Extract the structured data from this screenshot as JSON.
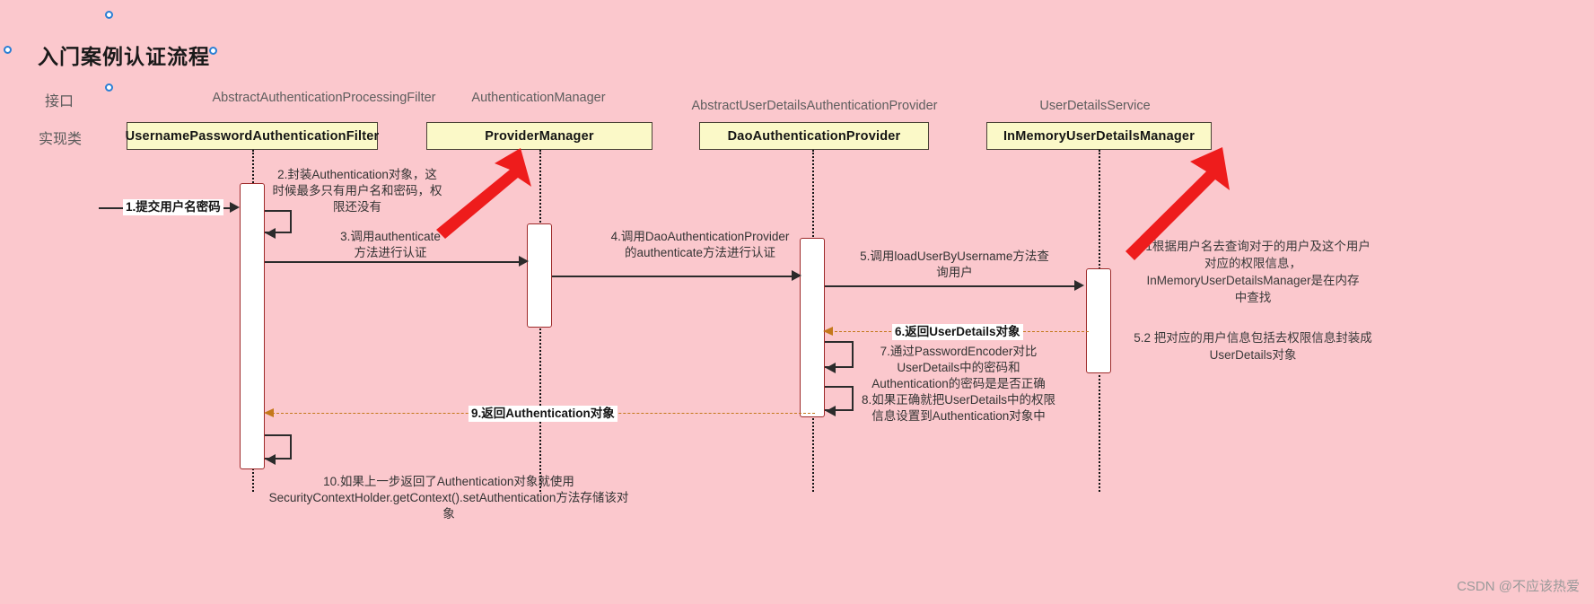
{
  "diagram": {
    "title": "入门案例认证流程",
    "background_color": "#fbc8cd",
    "participant_fill": "#fbf9c8",
    "activation_fill": "#ffffff",
    "activation_border": "#9e2a2a",
    "annotation_color": "#ee1c1c",
    "return_arrow_color": "#c4781b"
  },
  "legend": {
    "interface_row": "接口",
    "implementation_row": "实现类"
  },
  "participants": [
    {
      "interface": "AbstractAuthenticationProcessingFilter",
      "impl": "UsernamePasswordAuthenticationFilter"
    },
    {
      "interface": "AuthenticationManager",
      "impl": "ProviderManager"
    },
    {
      "interface": "AbstractUserDetailsAuthenticationProvider",
      "impl": "DaoAuthenticationProvider"
    },
    {
      "interface": "UserDetailsService",
      "impl": "InMemoryUserDetailsManager"
    }
  ],
  "messages": {
    "m1": "1.提交用户名密码",
    "m2": "2.封装Authentication对象，这\n时候最多只有用户名和密码，权\n限还没有",
    "m3": "3.调用authenticate\n方法进行认证",
    "m4": "4.调用DaoAuthenticationProvider\n的authenticate方法进行认证",
    "m5": "5.调用loadUserByUsername方法查\n询用户",
    "m51": "5.1根据用户名去查询对于的用户及这个用户\n对应的权限信息，\nInMemoryUserDetailsManager是在内存\n中查找",
    "m52": "5.2 把对应的用户信息包括去权限信息封装成\nUserDetails对象",
    "m6": "6.返回UserDetails对象",
    "m7": "7.通过PasswordEncoder对比\nUserDetails中的密码和\nAuthentication的密码是是否正确",
    "m8": "8.如果正确就把UserDetails中的权限\n信息设置到Authentication对象中",
    "m9": "9.返回Authentication对象",
    "m10": "10.如果上一步返回了Authentication对象就使用\nSecurityContextHolder.getContext().setAuthentication方法存储该对\n象"
  },
  "watermark": "CSDN @不应该热爱"
}
